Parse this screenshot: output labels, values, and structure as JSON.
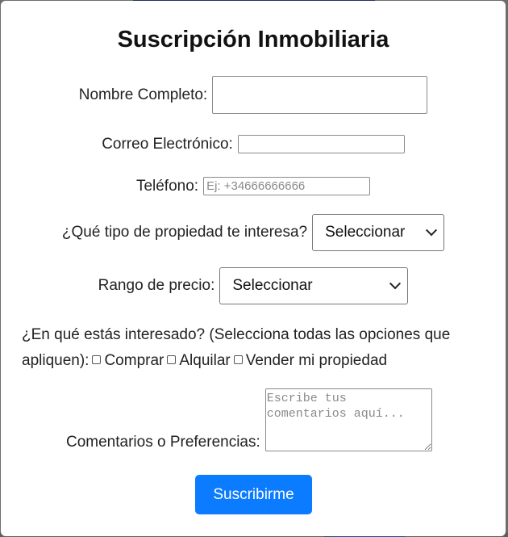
{
  "form": {
    "title": "Suscripción Inmobiliaria",
    "full_name": {
      "label": "Nombre Completo:",
      "value": ""
    },
    "email": {
      "label": "Correo Electrónico:",
      "value": ""
    },
    "phone": {
      "label": "Teléfono:",
      "placeholder": "Ej: +34666666666"
    },
    "property_type": {
      "label": "¿Qué tipo de propiedad te interesa?",
      "selected": "Seleccionar"
    },
    "price_range": {
      "label": "Rango de precio:",
      "selected": "Seleccionar"
    },
    "interest": {
      "label": "¿En qué estás interesado? (Selecciona todas las opciones que apliquen):",
      "options": [
        "Comprar",
        "Alquilar",
        "Vender mi propiedad"
      ]
    },
    "comments": {
      "label": "Comentarios o Preferencias:",
      "placeholder": "Escribe tus comentarios aquí..."
    },
    "submit_label": "Suscribirme"
  }
}
